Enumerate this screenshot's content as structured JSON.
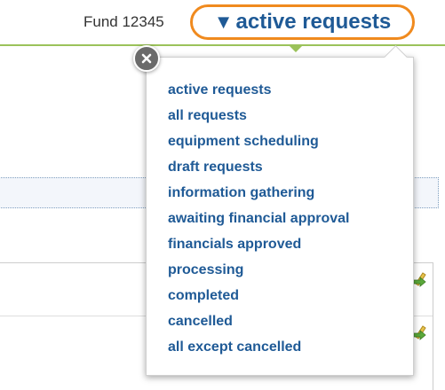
{
  "header": {
    "fund_label": "Fund 12345",
    "status_selected": "active requests",
    "caret_glyph": "▼",
    "accent_color": "#f08a1e",
    "link_color": "#1f5a96",
    "rule_color": "#9bc25a"
  },
  "status_menu": {
    "close_icon": "close-icon",
    "options": [
      {
        "label": "active requests"
      },
      {
        "label": "all requests"
      },
      {
        "label": "equipment scheduling"
      },
      {
        "label": "draft requests"
      },
      {
        "label": "information gathering"
      },
      {
        "label": "awaiting financial approval"
      },
      {
        "label": "financials approved"
      },
      {
        "label": "processing"
      },
      {
        "label": "completed"
      },
      {
        "label": "cancelled"
      },
      {
        "label": "all except cancelled"
      }
    ]
  },
  "table": {
    "row_icon": "edit-icon"
  }
}
